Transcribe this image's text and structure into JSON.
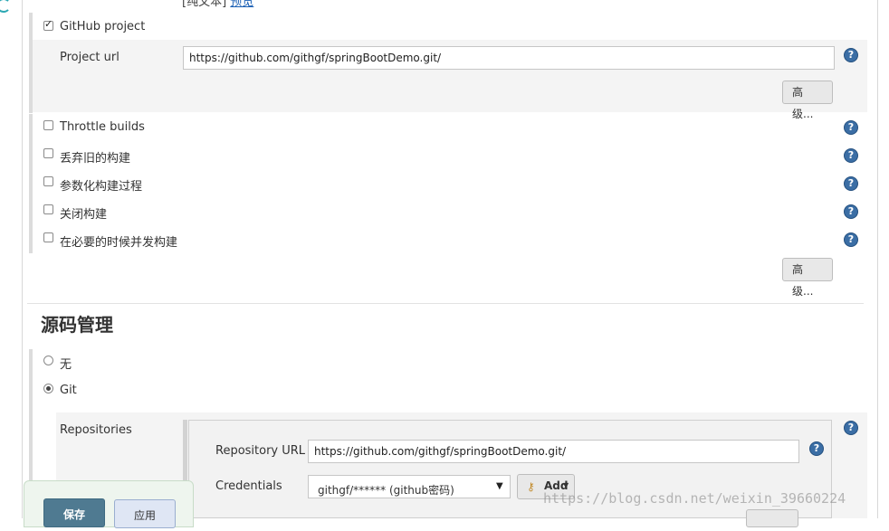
{
  "top_cut_text": "[纯文本]",
  "top_cut_link": "预览",
  "github": {
    "project_label": "GitHub project",
    "project_url_label": "Project url",
    "project_url_value": "https://github.com/githgf/springBootDemo.git/",
    "advanced_label": "高级..."
  },
  "options": [
    {
      "label": "Throttle builds",
      "checked": false
    },
    {
      "label": "丢弃旧的构建",
      "checked": false
    },
    {
      "label": "参数化构建过程",
      "checked": false
    },
    {
      "label": "关闭构建",
      "checked": false
    },
    {
      "label": "在必要的时候并发构建",
      "checked": false
    }
  ],
  "options_advanced_label": "高级...",
  "scm": {
    "title": "源码管理",
    "none_label": "无",
    "git_label": "Git",
    "repositories_label": "Repositories",
    "repo_url_label": "Repository URL",
    "repo_url_value": "https://github.com/githgf/springBootDemo.git/",
    "credentials_label": "Credentials",
    "credentials_value": "githgf/****** (github密码)",
    "add_label": "Add"
  },
  "bottom": {
    "save_label": "保存",
    "apply_label": "应用"
  },
  "help_glyph": "?",
  "watermark": "https://blog.csdn.net/weixin_39660224",
  "colors": {
    "save_button": "#4f7a91",
    "help_icon": "#3b6ea5",
    "panel_gray": "#f4f4f4"
  }
}
